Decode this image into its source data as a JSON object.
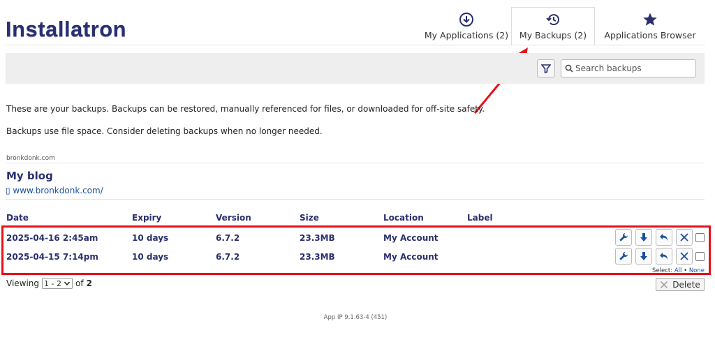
{
  "app": {
    "logo_text": "Installatron"
  },
  "tabs": [
    {
      "label": "My Applications (2)",
      "icon": "download-circle-icon"
    },
    {
      "label": "My Backups (2)",
      "icon": "history-icon",
      "active": true
    },
    {
      "label": "Applications Browser",
      "icon": "star-icon"
    }
  ],
  "toolbar": {
    "search_placeholder": "Search backups",
    "filter_icon": "filter-icon"
  },
  "intro": {
    "line1": "These are your backups. Backups can be restored, manually referenced for files, or downloaded for off-site safety.",
    "line2": "Backups use file space. Consider deleting backups when no longer needed."
  },
  "site": {
    "domain": "bronkdonk.com",
    "app_title": "My blog",
    "url": "▯ www.bronkdonk.com/"
  },
  "table": {
    "headers": {
      "date": "Date",
      "expiry": "Expiry",
      "version": "Version",
      "size": "Size",
      "location": "Location",
      "label": "Label"
    },
    "rows": [
      {
        "date": "2025-04-16 2:45am",
        "expiry": "10 days",
        "version": "6.7.2",
        "size": "23.3MB",
        "location": "My Account",
        "label": ""
      },
      {
        "date": "2025-04-15 7:14pm",
        "expiry": "10 days",
        "version": "6.7.2",
        "size": "23.3MB",
        "location": "My Account",
        "label": ""
      }
    ],
    "row_actions": [
      "wrench-icon",
      "download-arrow-icon",
      "restore-icon",
      "close-icon"
    ]
  },
  "select": {
    "prefix": "Select:",
    "all": "All",
    "sep": "•",
    "none": "None"
  },
  "pagination": {
    "viewing_label": "Viewing",
    "range": "1 - 2",
    "of_label": "of",
    "total": "2"
  },
  "delete_label": "Delete",
  "footer": {
    "text": "App IP 9.1.63-4 (451)"
  },
  "colors": {
    "brand": "#2a2f6e",
    "link": "#1a4fa0",
    "highlight": "#e8101a"
  }
}
